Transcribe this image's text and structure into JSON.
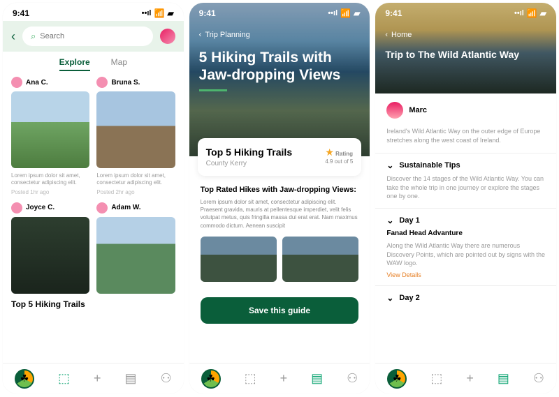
{
  "status_time": "9:41",
  "screen1": {
    "search_placeholder": "Search",
    "tabs": {
      "explore": "Explore",
      "map": "Map"
    },
    "cards": [
      {
        "name": "Ana C.",
        "desc": "Lorem ipsum dolor sit amet, consectetur adipiscing elit.",
        "posted": "Posted 1hr ago"
      },
      {
        "name": "Bruna S.",
        "desc": "Lorem ipsum dolor sit amet, consectetur adipiscing elit.",
        "posted": "Posted 2hr ago"
      },
      {
        "name": "Joyce C."
      },
      {
        "name": "Adam W."
      }
    ],
    "feed_title": "Top 5 Hiking Trails"
  },
  "screen2": {
    "back": "Trip Planning",
    "hero_title": "5 Hiking Trails with Jaw-dropping Views",
    "info_title": "Top 5 Hiking Trails",
    "info_sub": "County Kerry",
    "rating_label": "Rating",
    "rating_value": "4.9 out of 5",
    "section_title": "Top Rated Hikes with Jaw-dropping Views:",
    "section_text": "Lorem ipsum dolor sit amet, consectetur adipiscing elit. Praesent gravida, mauris at pellentesque imperdiet, velit felis volutpat metus, quis fringilla massa dui erat erat. Nam maximus commodo dictum. Aenean suscipit",
    "save_button": "Save this guide"
  },
  "screen3": {
    "back": "Home",
    "hero_title": "Trip to The Wild Atlantic Way",
    "author": "Marc",
    "intro": "Ireland's Wild Atlantic Way on the outer edge of Europe stretches along the west coast of Ireland.",
    "tips_title": "Sustainable Tips",
    "tips_body": "Discover the 14 stages of the Wild Atlantic Way. You can take the whole trip in one journey or explore the stages one by one.",
    "day1_title": "Day 1",
    "day1_sub": "Fanad Head Advanture",
    "day1_body": "Along the Wild Atlantic Way there are numerous Discovery Points, which are pointed out by signs with the WAW logo.",
    "view_details": "View Details",
    "day2_title": "Day 2"
  }
}
